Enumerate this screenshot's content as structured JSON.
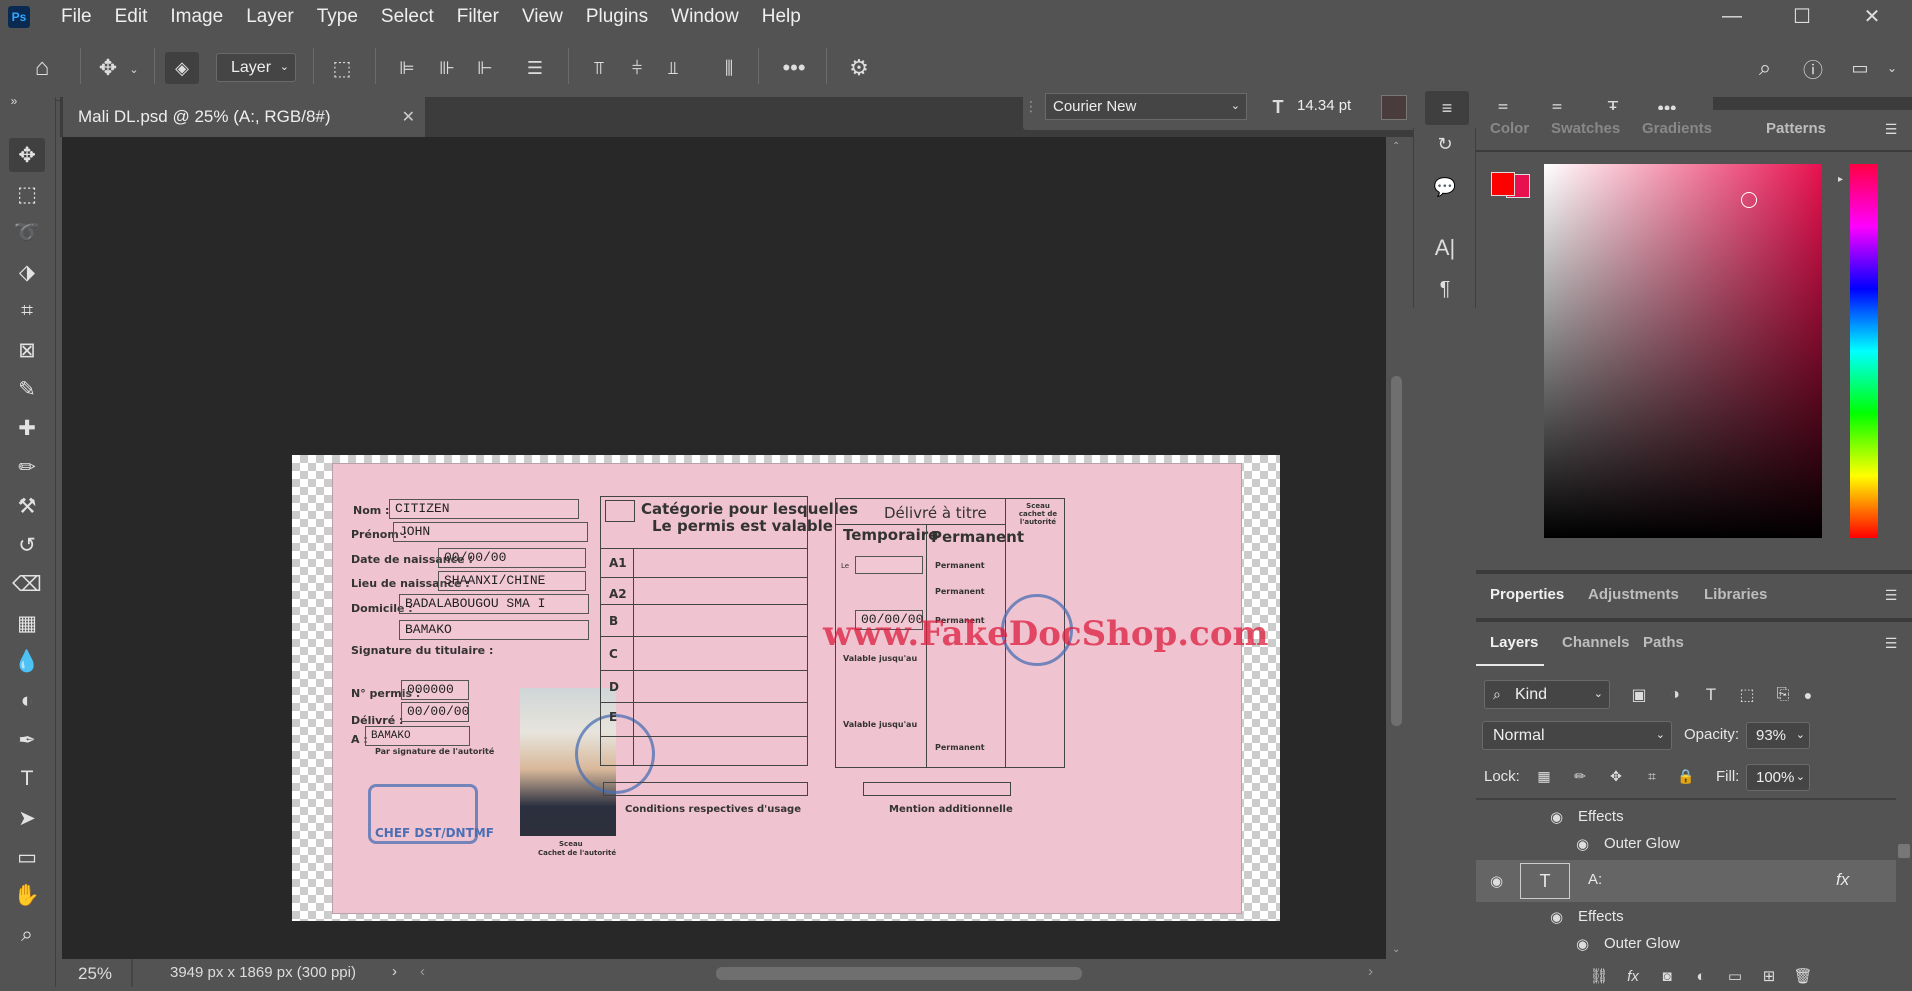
{
  "app": {
    "logo": "Ps",
    "menu": [
      "File",
      "Edit",
      "Image",
      "Layer",
      "Type",
      "Select",
      "Filter",
      "View",
      "Plugins",
      "Window",
      "Help"
    ]
  },
  "options_bar": {
    "layer_select": "Layer"
  },
  "type_options": {
    "font": "Courier New",
    "size": "14.34 pt"
  },
  "document": {
    "tab_title": "Mali DL.psd @ 25% (A:, RGB/8#)",
    "zoom": "25%",
    "dimensions": "3949 px x 1869 px (300 ppi)"
  },
  "card": {
    "nom_label": "Nom :",
    "nom": "CITIZEN",
    "prenom_label": "Prénom :",
    "prenom": "JOHN",
    "dob_label": "Date de naissance :",
    "dob": "00/00/00",
    "pob_label": "Lieu de naissance :",
    "pob": "SHAANXI/CHINE",
    "domicile_label": "Domicile :",
    "domicile1": "BADALABOUGOU SMA I",
    "domicile2": "BAMAKO",
    "signature_label": "Signature du titulaire :",
    "permis_label": "N° permis :",
    "permis": "000000",
    "delivre_label": "Délivré :",
    "delivre": "00/00/00",
    "a_label": "A :",
    "a_value": "BAMAKO",
    "par_sig": "Par signature de l'autorité",
    "sceau": "Sceau",
    "cachet": "Cachet de l'autorité",
    "stamp_text": "CHEF DST/DNTMF",
    "categorie_title": "Catégorie pour lesquelles",
    "categorie_sub": "Le permis est valable",
    "categories": [
      "A1",
      "A2",
      "B",
      "C",
      "D",
      "E"
    ],
    "conditions": "Conditions respectives d'usage",
    "delivre_titre": "Délivré à titre",
    "temporaire": "Temporaire",
    "permanent": "Permanent",
    "sceau_right": "Sceau cachet de l'autorité",
    "le": "Le",
    "permanent_small": "Permanent",
    "date_value": "00/00/00",
    "valable": "Valable jusqu'au",
    "mention": "Mention additionnelle",
    "watermark": "www.FakeDocShop.com"
  },
  "color_panel": {
    "tabs": [
      "Color",
      "Swatches",
      "Gradients",
      "Patterns"
    ],
    "fg_color": "#ff0000",
    "bg_color": "#e8114f"
  },
  "properties_panel": {
    "tabs": [
      "Properties",
      "Adjustments",
      "Libraries"
    ]
  },
  "layers_panel": {
    "tabs": [
      "Layers",
      "Channels",
      "Paths"
    ],
    "kind": "Kind",
    "blend_mode": "Normal",
    "opacity_label": "Opacity:",
    "opacity": "93%",
    "lock_label": "Lock:",
    "fill_label": "Fill:",
    "fill": "100%",
    "rows": [
      {
        "name": "Effects"
      },
      {
        "name": "Outer Glow"
      },
      {
        "name": "A:"
      },
      {
        "name": "Effects"
      },
      {
        "name": "Outer Glow"
      }
    ]
  }
}
